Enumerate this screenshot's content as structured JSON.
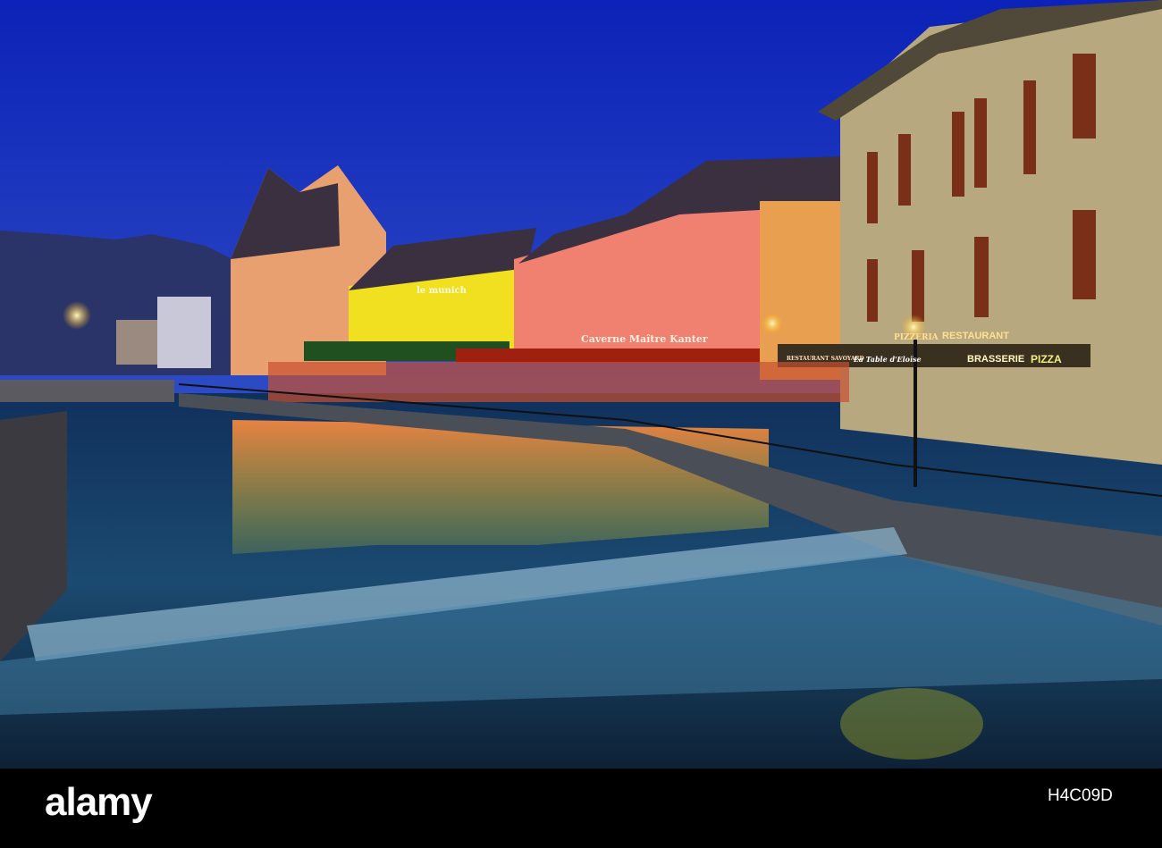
{
  "photo": {
    "signs": {
      "le_munich": "le munich",
      "caverne": "Caverne Maître Kanter",
      "pizzeria": "PIZZERIA",
      "restaurant": "RESTAURANT",
      "restaurant_savoyard": "RESTAURANT SAVOYARD",
      "la_table": "La Table d'Eloïse",
      "brasserie": "BRASSERIE",
      "pizza": "PIZZA"
    },
    "colors": {
      "sky": "#1436c8",
      "water": "#0f2a4a",
      "glow": "#ffd040"
    }
  },
  "footer": {
    "logo": "alamy",
    "image_id": "H4C09D"
  }
}
